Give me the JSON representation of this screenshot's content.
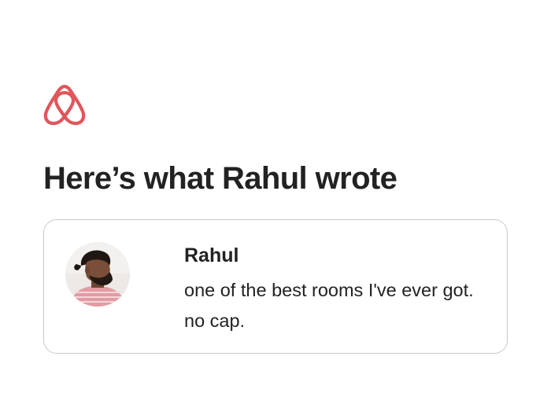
{
  "brand": {
    "logo_icon": "airbnb-logo-icon",
    "accent_color": "#e0565b"
  },
  "page": {
    "title": "Here’s what Rahul wrote"
  },
  "review": {
    "reviewer_name": "Rahul",
    "avatar_icon": "reviewer-avatar",
    "text": "one of the best rooms I've ever got. no cap."
  },
  "colors": {
    "text": "#222222",
    "card_border": "#c9c9c9",
    "background": "#ffffff"
  }
}
